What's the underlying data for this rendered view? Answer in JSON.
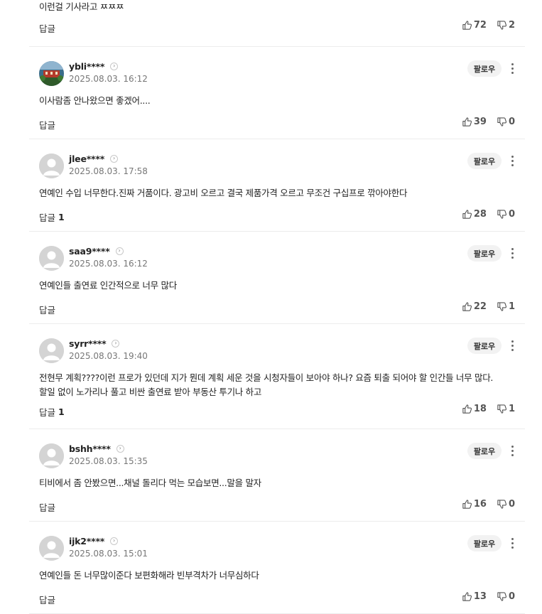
{
  "labels": {
    "reply": "답글",
    "follow": "팔로우"
  },
  "comments": [
    {
      "username": "",
      "date": "",
      "text": "이런걸 기사라고 ㅉㅉㅉ",
      "reply_count": "",
      "likes": "72",
      "dislikes": "2"
    },
    {
      "username": "ybli****",
      "date": "2025.08.03. 16:12",
      "text": "이사람좀 안나왔으면 좋겠어....",
      "reply_count": "",
      "likes": "39",
      "dislikes": "0"
    },
    {
      "username": "jlee****",
      "date": "2025.08.03. 17:58",
      "text": "연예인 수입 너무한다.진짜 거품이다. 광고비 오르고 결국 제품가격 오르고 무조건 구십프로 깎아야한다",
      "reply_count": "1",
      "likes": "28",
      "dislikes": "0"
    },
    {
      "username": "saa9****",
      "date": "2025.08.03. 16:12",
      "text": "연예인들 출연료 인간적으로 너무 많다",
      "reply_count": "",
      "likes": "22",
      "dislikes": "1"
    },
    {
      "username": "syrr****",
      "date": "2025.08.03. 19:40",
      "text": "전현무 계획????이런 프로가 있던데 지가 뭔데 계획 세운 것을 시청자들이 보아야 하나? 요즘 퇴출 되어야 할 인간들 너무 많다.할일 없이 노가리나 풀고 비싼 출연료 받아 부동산 투기나 하고",
      "reply_count": "1",
      "likes": "18",
      "dislikes": "1"
    },
    {
      "username": "bshh****",
      "date": "2025.08.03. 15:35",
      "text": "티비에서 좀 안봤으면...채널 돌리다 먹는 모습보면...말을 말자",
      "reply_count": "",
      "likes": "16",
      "dislikes": "0"
    },
    {
      "username": "ijk2****",
      "date": "2025.08.03. 15:01",
      "text": "연예인들 돈 너무많이준다 보편화해라 빈부격차가 너무심하다",
      "reply_count": "",
      "likes": "13",
      "dislikes": "0"
    }
  ]
}
